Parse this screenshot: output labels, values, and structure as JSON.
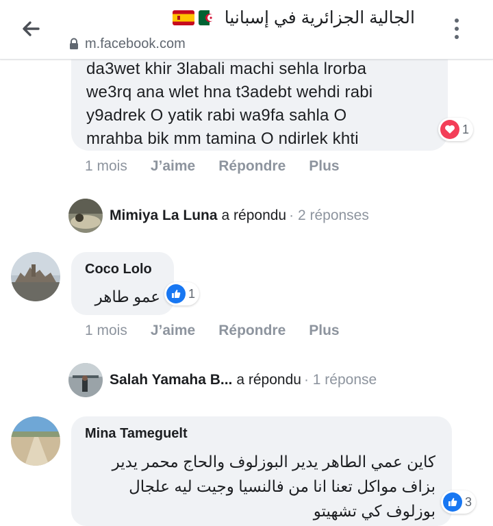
{
  "header": {
    "title": "الجالية الجزائرية في إسبانيا",
    "url": "m.facebook.com"
  },
  "comment1": {
    "text_lines": [
      "da3wet khir 3labali machi sehla lrorba",
      "we3rq ana wlet hna t3adebt wehdi rabi",
      "y9adrek O yatik rabi wa9fa sahla O",
      "mrahba bik mm tamina O ndirlek khti"
    ],
    "reaction_count": "1",
    "actions": {
      "time": "1 mois",
      "like": "J’aime",
      "reply": "Répondre",
      "more": "Plus"
    }
  },
  "reply_summary1": {
    "name": "Mimiya La Luna",
    "verb": "a répondu",
    "count": "· 2 réponses"
  },
  "comment2": {
    "author": "Coco Lolo",
    "text": "عمو طاهر",
    "reaction_count": "1",
    "actions": {
      "time": "1 mois",
      "like": "J’aime",
      "reply": "Répondre",
      "more": "Plus"
    }
  },
  "reply_summary2": {
    "name": "Salah Yamaha B...",
    "verb": "a répondu",
    "count": "· 1 réponse"
  },
  "comment3": {
    "author": "Mina Tameguelt",
    "text_lines": [
      "كاين عمي الطاهر يدير البوزلوف والحاج محمر يدير",
      "بزاف مواكل تعنا انا من فالنسيا وجيت ليه علجال",
      "بوزلوف كي تشهيتو"
    ],
    "reaction_count": "3"
  },
  "colors": {
    "accent": "#1877f2",
    "love": "#f33e58",
    "muted": "#8d949e",
    "bubble": "#f0f2f5"
  }
}
